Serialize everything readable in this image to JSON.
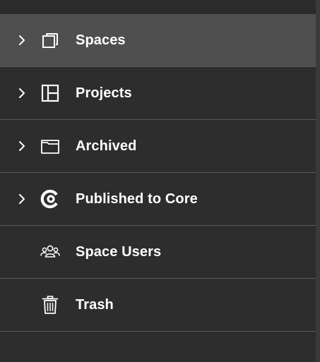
{
  "colors": {
    "background": "#2d2d2d",
    "selected_background": "#4f4f4f",
    "divider": "#5a5a5a",
    "text": "#ffffff"
  },
  "nav": {
    "items": [
      {
        "label": "Spaces",
        "icon": "spaces-icon",
        "has_chevron": true,
        "selected": true
      },
      {
        "label": "Projects",
        "icon": "projects-icon",
        "has_chevron": true,
        "selected": false
      },
      {
        "label": "Archived",
        "icon": "archive-box-icon",
        "has_chevron": true,
        "selected": false
      },
      {
        "label": "Published to Core",
        "icon": "core-logo-icon",
        "has_chevron": true,
        "selected": false
      },
      {
        "label": "Space Users",
        "icon": "users-group-icon",
        "has_chevron": false,
        "selected": false
      },
      {
        "label": "Trash",
        "icon": "trash-icon",
        "has_chevron": false,
        "selected": false
      }
    ]
  }
}
